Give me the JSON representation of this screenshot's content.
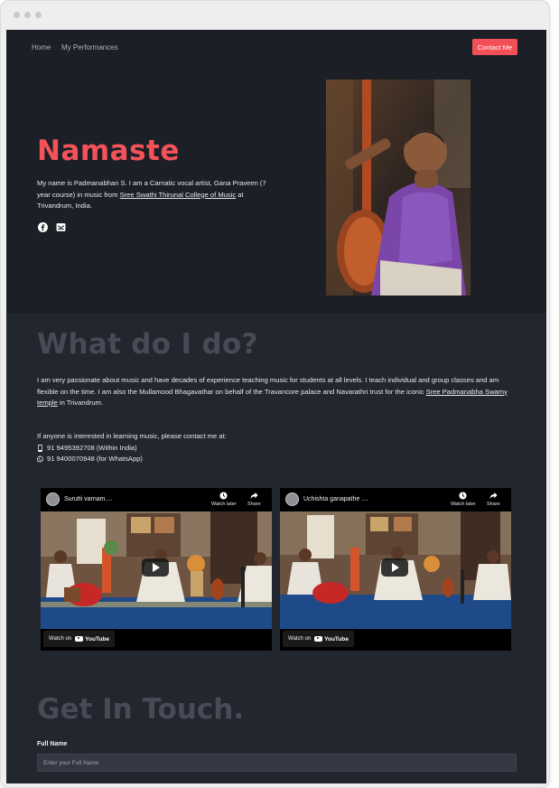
{
  "nav": {
    "home": "Home",
    "performances": "My Performances",
    "contact_button": "Contact Me"
  },
  "hero": {
    "title": "Namaste",
    "bio_text": "My name is Padmanabhan S. I am a Carnatic vocal artist, Gana Praveen (7 year course) in music from ",
    "bio_link": "Sree Swathi Thirunal College of Music",
    "bio_tail": " at Trivandrum, India.",
    "social_icons": [
      "facebook-icon",
      "mail-icon"
    ]
  },
  "about": {
    "title": "What do I do?",
    "paragraph": "I am very passionate about music and have decades of experience teaching music for students at all levels. I teach individual and group classes and am flexible on the time. I am also the Mullamood Bhagavathar on behalf of the Travancore palace and Navarathri trust for the iconic ",
    "paragraph_link": "Sree Padmanabha Swamy temple",
    "paragraph_tail": " in Trivandrum.",
    "contact_intro": "If anyone is interested in learning music, please contact me at:",
    "phone": "91 9495392708 (Within India)",
    "whatsapp": "91 9400070948 (for WhatsApp)"
  },
  "videos": [
    {
      "title": "Surutti varnam....",
      "watch_later": "Watch later",
      "share": "Share",
      "watch_on": "Watch on",
      "yt": "YouTube"
    },
    {
      "title": "Uchishta ganapathe ....",
      "watch_later": "Watch later",
      "share": "Share",
      "watch_on": "Watch on",
      "yt": "YouTube"
    }
  ],
  "contact": {
    "title": "Get In Touch.",
    "full_name_label": "Full Name",
    "full_name_placeholder": "Enter your Full Name"
  },
  "colors": {
    "accent": "#f24f57",
    "hero_bg": "#1c1f26",
    "page_bg": "#22262e",
    "muted_heading": "#464b55"
  }
}
